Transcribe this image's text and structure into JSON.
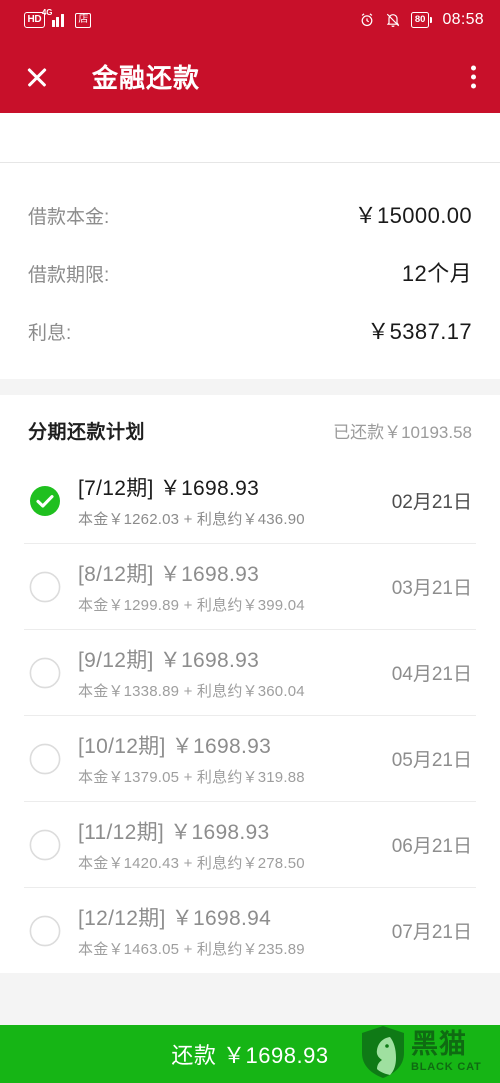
{
  "status_bar": {
    "hd_label": "HD",
    "network_label": "4G",
    "shop_icon_label": "店",
    "alarm_icon": "alarm-clock",
    "mute_icon": "bell-muted",
    "battery_level": "80",
    "time": "08:58"
  },
  "app_bar": {
    "close_icon": "close-icon",
    "title": "金融还款",
    "menu_icon": "overflow-menu-icon"
  },
  "summary": {
    "rows": [
      {
        "label": "借款本金:",
        "value": "￥15000.00"
      },
      {
        "label": "借款期限:",
        "value": "12个月"
      },
      {
        "label": "利息:",
        "value": "￥5387.17"
      }
    ]
  },
  "plan": {
    "title": "分期还款计划",
    "paid_label": "已还款￥10193.58",
    "installments": [
      {
        "period": "[7/12期]",
        "amount": "￥1698.93",
        "title": "[7/12期] ￥1698.93",
        "detail": "本金￥1262.03 + 利息约￥436.90",
        "date": "02月21日",
        "paid": true
      },
      {
        "period": "[8/12期]",
        "amount": "￥1698.93",
        "title": "[8/12期] ￥1698.93",
        "detail": "本金￥1299.89 + 利息约￥399.04",
        "date": "03月21日",
        "paid": false
      },
      {
        "period": "[9/12期]",
        "amount": "￥1698.93",
        "title": "[9/12期] ￥1698.93",
        "detail": "本金￥1338.89 + 利息约￥360.04",
        "date": "04月21日",
        "paid": false
      },
      {
        "period": "[10/12期]",
        "amount": "￥1698.93",
        "title": "[10/12期] ￥1698.93",
        "detail": "本金￥1379.05 + 利息约￥319.88",
        "date": "05月21日",
        "paid": false
      },
      {
        "period": "[11/12期]",
        "amount": "￥1698.93",
        "title": "[11/12期] ￥1698.93",
        "detail": "本金￥1420.43 + 利息约￥278.50",
        "date": "06月21日",
        "paid": false
      },
      {
        "period": "[12/12期]",
        "amount": "￥1698.94",
        "title": "[12/12期] ￥1698.94",
        "detail": "本金￥1463.05 + 利息约￥235.89",
        "date": "07月21日",
        "paid": false
      }
    ]
  },
  "pay_bar": {
    "label": "还款 ￥1698.93"
  },
  "watermark": {
    "cn": "黑猫",
    "en": "BLACK CAT",
    "icon": "shield-cat-logo"
  },
  "colors": {
    "header_red": "#c8102a",
    "pay_green": "#16b515",
    "check_green": "#1fc01f",
    "page_bg": "#f4f4f4"
  }
}
